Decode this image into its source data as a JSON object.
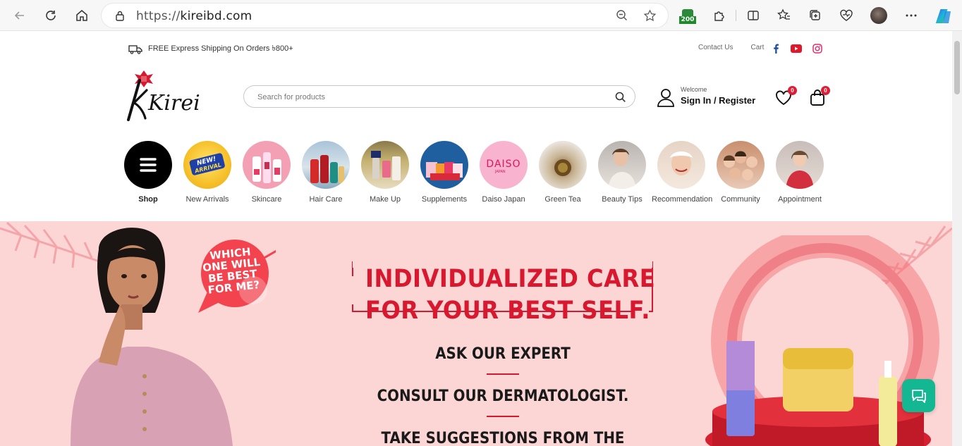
{
  "browser": {
    "url_scheme": "https://",
    "url_host": "kireibd.com",
    "badge_count": "200"
  },
  "topbar": {
    "shipping_text": "FREE Express Shipping On Orders ৳800+",
    "contact_label": "Contact Us",
    "cart_label": "Cart",
    "social": [
      "facebook-icon",
      "youtube-icon",
      "instagram-icon"
    ]
  },
  "header": {
    "logo_text": "Kirei",
    "search_placeholder": "Search for products",
    "welcome": "Welcome",
    "signin": "Sign In / Register",
    "wishlist_count": "0",
    "cart_count": "0"
  },
  "categories": [
    {
      "label": "Shop"
    },
    {
      "label": "New Arrivals"
    },
    {
      "label": "Skincare"
    },
    {
      "label": "Hair Care"
    },
    {
      "label": "Make Up"
    },
    {
      "label": "Supplements"
    },
    {
      "label": "Daiso Japan"
    },
    {
      "label": "Green Tea"
    },
    {
      "label": "Beauty Tips"
    },
    {
      "label": "Recommendation"
    },
    {
      "label": "Community"
    },
    {
      "label": "Appointment"
    }
  ],
  "hero": {
    "bubble_text": "WHICH ONE WILL BE BEST FOR ME?",
    "title_line1": "INDIVIDUALIZED CARE",
    "title_line2": "FOR YOUR BEST SELF.",
    "line1": "ASK OUR EXPERT",
    "line2": "CONSULT OUR DERMATOLOGIST.",
    "line3": "TAKE SUGGESTIONS FROM THE"
  },
  "badges": {
    "new_arrival_1": "NEW!",
    "new_arrival_2": "ARRIVAL",
    "daiso": "DAISO",
    "daiso_sub": "JAPAN"
  },
  "colors": {
    "brand_red": "#d8182f",
    "hero_bg": "#fcd5d5",
    "chat_green": "#13b892"
  }
}
